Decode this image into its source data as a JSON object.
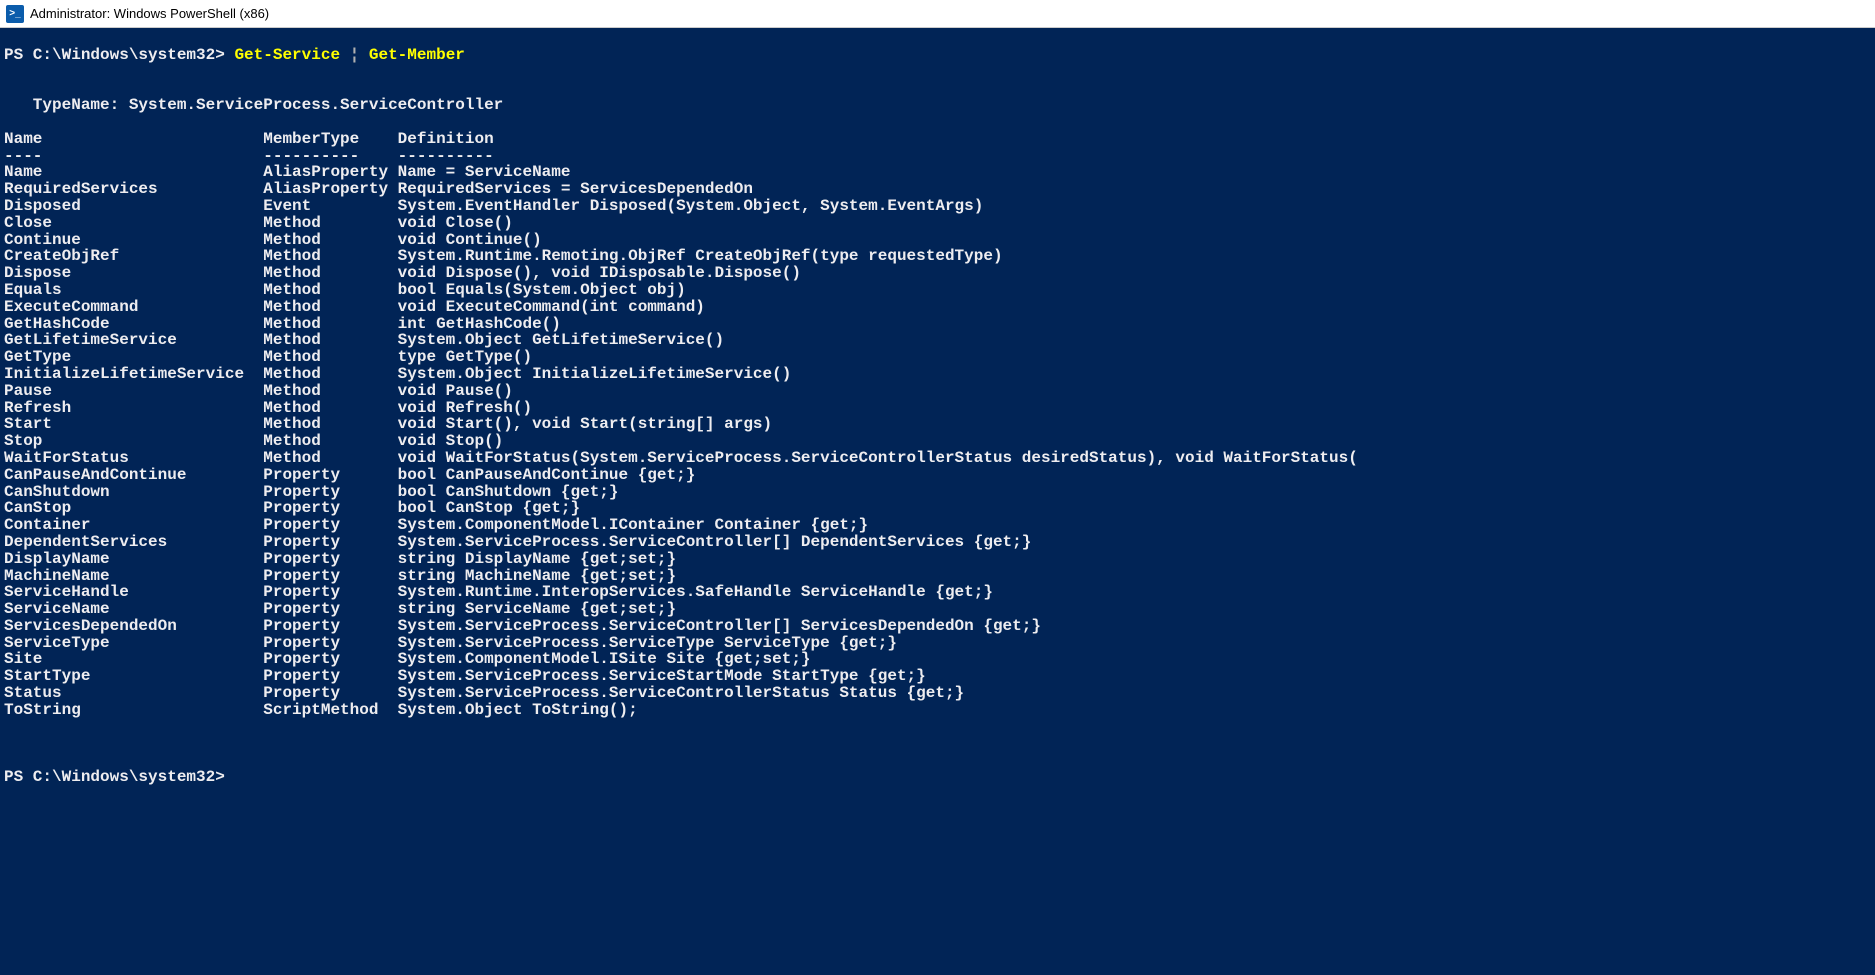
{
  "titlebar": {
    "icon_text": ">_",
    "title": "Administrator: Windows PowerShell (x86)"
  },
  "prompt1": {
    "prefix": "PS C:\\Windows\\system32> ",
    "cmd1": "Get-Service",
    "pipe": " ¦ ",
    "cmd2": "Get-Member"
  },
  "typename_line": "   TypeName: System.ServiceProcess.ServiceController",
  "headers": {
    "name": "Name",
    "type": "MemberType",
    "def": "Definition"
  },
  "underlines": {
    "name": "----",
    "type": "----------",
    "def": "----------"
  },
  "members": [
    {
      "name": "Name",
      "type": "AliasProperty",
      "def": "Name = ServiceName"
    },
    {
      "name": "RequiredServices",
      "type": "AliasProperty",
      "def": "RequiredServices = ServicesDependedOn"
    },
    {
      "name": "Disposed",
      "type": "Event",
      "def": "System.EventHandler Disposed(System.Object, System.EventArgs)"
    },
    {
      "name": "Close",
      "type": "Method",
      "def": "void Close()"
    },
    {
      "name": "Continue",
      "type": "Method",
      "def": "void Continue()"
    },
    {
      "name": "CreateObjRef",
      "type": "Method",
      "def": "System.Runtime.Remoting.ObjRef CreateObjRef(type requestedType)"
    },
    {
      "name": "Dispose",
      "type": "Method",
      "def": "void Dispose(), void IDisposable.Dispose()"
    },
    {
      "name": "Equals",
      "type": "Method",
      "def": "bool Equals(System.Object obj)"
    },
    {
      "name": "ExecuteCommand",
      "type": "Method",
      "def": "void ExecuteCommand(int command)"
    },
    {
      "name": "GetHashCode",
      "type": "Method",
      "def": "int GetHashCode()"
    },
    {
      "name": "GetLifetimeService",
      "type": "Method",
      "def": "System.Object GetLifetimeService()"
    },
    {
      "name": "GetType",
      "type": "Method",
      "def": "type GetType()"
    },
    {
      "name": "InitializeLifetimeService",
      "type": "Method",
      "def": "System.Object InitializeLifetimeService()"
    },
    {
      "name": "Pause",
      "type": "Method",
      "def": "void Pause()"
    },
    {
      "name": "Refresh",
      "type": "Method",
      "def": "void Refresh()"
    },
    {
      "name": "Start",
      "type": "Method",
      "def": "void Start(), void Start(string[] args)"
    },
    {
      "name": "Stop",
      "type": "Method",
      "def": "void Stop()"
    },
    {
      "name": "WaitForStatus",
      "type": "Method",
      "def": "void WaitForStatus(System.ServiceProcess.ServiceControllerStatus desiredStatus), void WaitForStatus("
    },
    {
      "name": "CanPauseAndContinue",
      "type": "Property",
      "def": "bool CanPauseAndContinue {get;}"
    },
    {
      "name": "CanShutdown",
      "type": "Property",
      "def": "bool CanShutdown {get;}"
    },
    {
      "name": "CanStop",
      "type": "Property",
      "def": "bool CanStop {get;}"
    },
    {
      "name": "Container",
      "type": "Property",
      "def": "System.ComponentModel.IContainer Container {get;}"
    },
    {
      "name": "DependentServices",
      "type": "Property",
      "def": "System.ServiceProcess.ServiceController[] DependentServices {get;}"
    },
    {
      "name": "DisplayName",
      "type": "Property",
      "def": "string DisplayName {get;set;}"
    },
    {
      "name": "MachineName",
      "type": "Property",
      "def": "string MachineName {get;set;}"
    },
    {
      "name": "ServiceHandle",
      "type": "Property",
      "def": "System.Runtime.InteropServices.SafeHandle ServiceHandle {get;}"
    },
    {
      "name": "ServiceName",
      "type": "Property",
      "def": "string ServiceName {get;set;}"
    },
    {
      "name": "ServicesDependedOn",
      "type": "Property",
      "def": "System.ServiceProcess.ServiceController[] ServicesDependedOn {get;}"
    },
    {
      "name": "ServiceType",
      "type": "Property",
      "def": "System.ServiceProcess.ServiceType ServiceType {get;}"
    },
    {
      "name": "Site",
      "type": "Property",
      "def": "System.ComponentModel.ISite Site {get;set;}"
    },
    {
      "name": "StartType",
      "type": "Property",
      "def": "System.ServiceProcess.ServiceStartMode StartType {get;}"
    },
    {
      "name": "Status",
      "type": "Property",
      "def": "System.ServiceProcess.ServiceControllerStatus Status {get;}"
    },
    {
      "name": "ToString",
      "type": "ScriptMethod",
      "def": "System.Object ToString();"
    }
  ],
  "prompt2": "PS C:\\Windows\\system32>"
}
